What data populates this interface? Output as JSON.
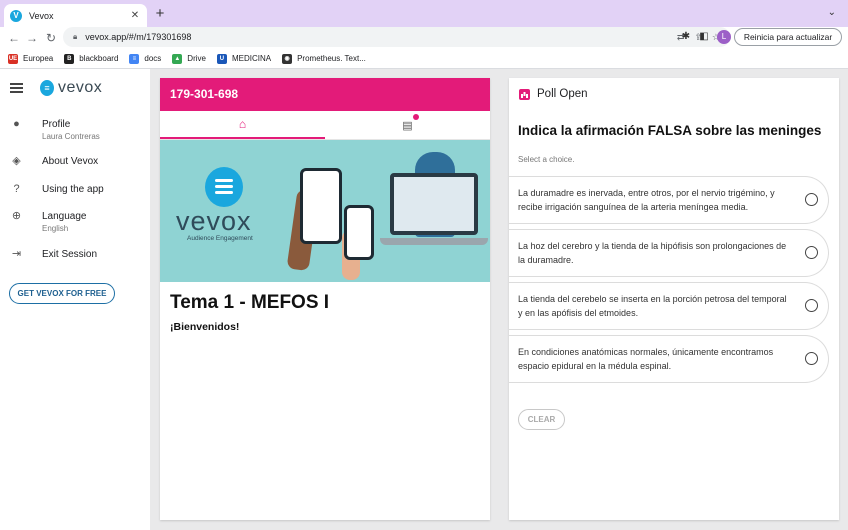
{
  "browser": {
    "tab_title": "Vevox",
    "tab_close": "✕",
    "new_tab": "+",
    "url": "vevox.app/#/m/179301698",
    "profile_initial": "L",
    "update_label": "Reinicia para actualizar",
    "bookmarks": [
      {
        "label": "Europea",
        "color": "#d93025",
        "icon": "UE"
      },
      {
        "label": "blackboard",
        "color": "#222222",
        "icon": "B"
      },
      {
        "label": "docs",
        "color": "#4285f4",
        "icon": "≡"
      },
      {
        "label": "Drive",
        "color": "#34a853",
        "icon": "▲"
      },
      {
        "label": "MEDICINA",
        "color": "#1a57b8",
        "icon": "U"
      },
      {
        "label": "Prometheus. Text...",
        "color": "#333333",
        "icon": "◉"
      }
    ]
  },
  "sidebar": {
    "logo": "vevox",
    "items": [
      {
        "label": "Profile",
        "sub": "Laura Contreras",
        "icon": "account-icon"
      },
      {
        "label": "About Vevox",
        "sub": "",
        "icon": "compass-icon"
      },
      {
        "label": "Using the app",
        "sub": "",
        "icon": "help-icon"
      },
      {
        "label": "Language",
        "sub": "English",
        "icon": "globe-icon"
      },
      {
        "label": "Exit Session",
        "sub": "",
        "icon": "exit-icon"
      }
    ],
    "cta": "GET VEVOX FOR FREE"
  },
  "session": {
    "pin": "179-301-698",
    "banner_logo": "vevox",
    "banner_tagline": "Audience Engagement",
    "title": "Tema 1 - MEFOS I",
    "welcome": "¡Bienvenidos!"
  },
  "poll": {
    "status": "Poll Open",
    "question": "Indica la afirmación FALSA sobre las meninges",
    "hint": "Select a choice.",
    "choices": [
      "La duramadre es inervada, entre otros, por el nervio trigémino, y recibe irrigación sanguínea de la arteria meníngea media.",
      "La hoz del cerebro y la tienda de la hipófisis son prolongaciones de la duramadre.",
      "La tienda del cerebelo se inserta en la porción petrosa del temporal y en las apófisis del etmoides.",
      "En condiciones anatómicas normales, únicamente encontramos espacio epidural en la médula espinal."
    ],
    "clear": "CLEAR"
  },
  "colors": {
    "brand_pink": "#e31b79",
    "vevox_blue": "#1aa7de",
    "chrome_tabstrip": "#e2d2f6"
  }
}
